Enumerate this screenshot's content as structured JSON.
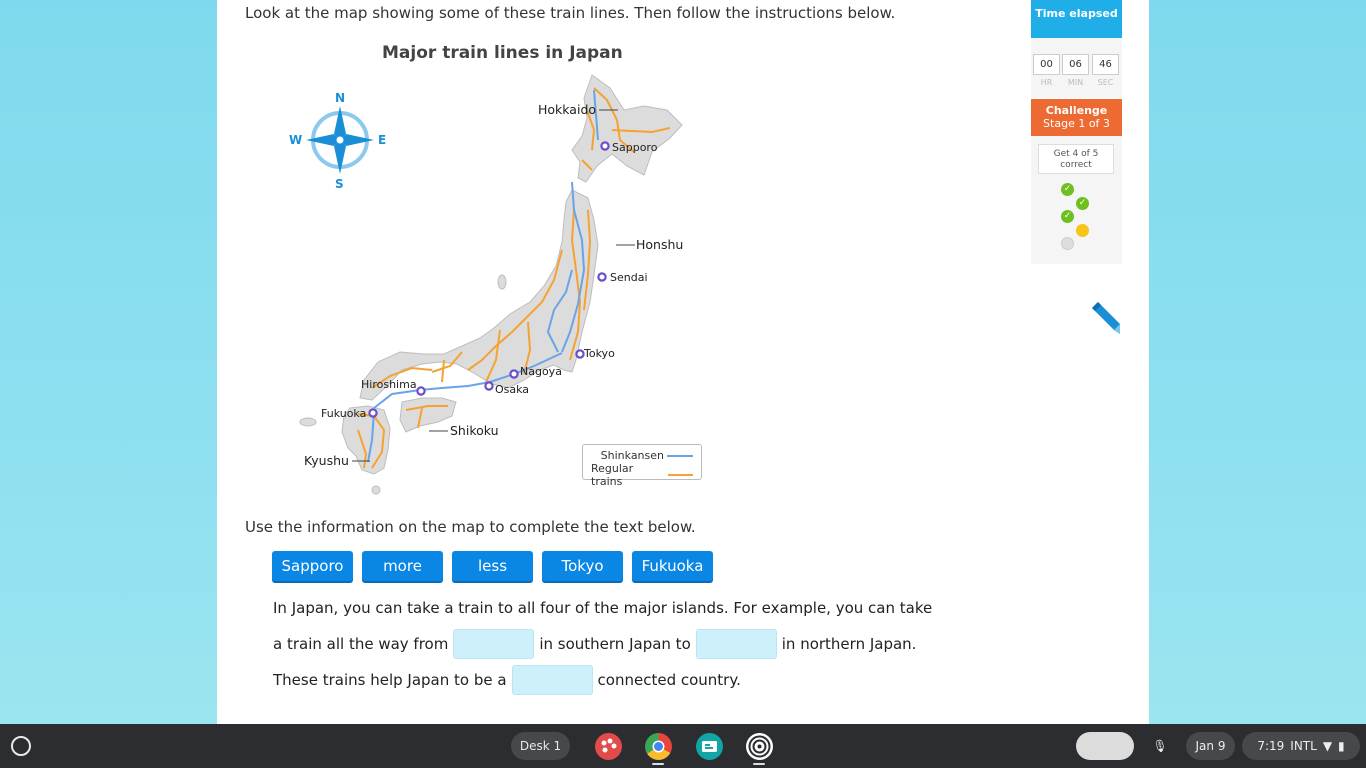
{
  "instructions": "Look at the map showing some of these train lines. Then follow the instructions below.",
  "map": {
    "title": "Major train lines in Japan",
    "compass": {
      "n": "N",
      "e": "E",
      "s": "S",
      "w": "W"
    },
    "islands": {
      "hokkaido": "Hokkaido",
      "honshu": "Honshu",
      "shikoku": "Shikoku",
      "kyushu": "Kyushu"
    },
    "cities": {
      "sapporo": "Sapporo",
      "sendai": "Sendai",
      "tokyo": "Tokyo",
      "nagoya": "Nagoya",
      "osaka": "Osaka",
      "hiroshima": "Hiroshima",
      "fukuoka": "Fukuoka"
    },
    "legend": {
      "shinkansen": "Shinkansen",
      "regular": "Regular trains"
    },
    "colors": {
      "shinkansen": "#6aa3e6",
      "regular": "#f4a333",
      "land": "#dcdcdc",
      "city": "#6a4fc9"
    }
  },
  "use_info": "Use the information on the map to complete the text below.",
  "tiles": [
    "Sapporo",
    "more",
    "less",
    "Tokyo",
    "Fukuoka"
  ],
  "passage": {
    "line1": "In Japan, you can take a train to all four of the major islands. For example, you can take",
    "line2_a": "a train all the way from",
    "line2_b": "in southern Japan to",
    "line2_c": "in northern Japan.",
    "line3_a": "These trains help Japan to be a",
    "line3_b": "connected country."
  },
  "sidebar": {
    "time_title": "Time elapsed",
    "hr": "00",
    "min": "06",
    "sec": "46",
    "hr_label": "HR",
    "min_label": "MIN",
    "sec_label": "SEC",
    "challenge_title": "Challenge",
    "challenge_stage": "Stage 1 of 3",
    "goal": "Get 4 of 5 correct",
    "progress": [
      "correct",
      "correct",
      "correct",
      "current",
      "pending"
    ]
  },
  "taskbar": {
    "desk": "Desk 1",
    "date": "Jan 9",
    "time": "7:19",
    "locale": "INTL"
  }
}
